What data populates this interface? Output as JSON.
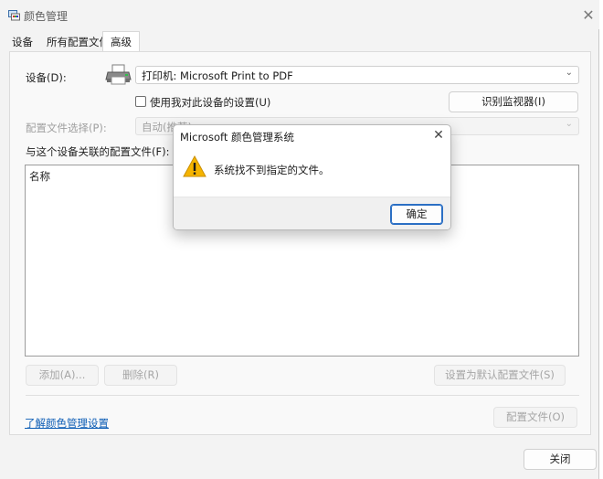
{
  "window": {
    "title": "颜色管理",
    "close_glyph": "✕"
  },
  "tabs": [
    {
      "label": "设备",
      "active": false
    },
    {
      "label": "所有配置文件",
      "active": false
    },
    {
      "label": "高级",
      "active": true
    }
  ],
  "device": {
    "label": "设备(D):",
    "selected": "打印机: Microsoft Print to PDF",
    "use_settings_label": "使用我对此设备的设置(U)",
    "use_settings_checked": false,
    "identify_button": "识别监视器(I)"
  },
  "profile_selection": {
    "label": "配置文件选择(P):",
    "selected": "自动(推荐)"
  },
  "associated_profiles": {
    "label": "与这个设备关联的配置文件(F):",
    "column_header": "名称",
    "rows": []
  },
  "actions": {
    "add": "添加(A)...",
    "remove": "删除(R)",
    "set_default": "设置为默认配置文件(S)",
    "profiles": "配置文件(O)"
  },
  "footer": {
    "learn_more_link": "了解颜色管理设置",
    "close_button": "关闭"
  },
  "dialog": {
    "title": "Microsoft 颜色管理系统",
    "close_glyph": "✕",
    "message": "系统找不到指定的文件。",
    "ok_button": "确定",
    "icon": "warning-icon"
  },
  "icons": {
    "chevron": "⌄"
  },
  "colors": {
    "link": "#0b5cb5",
    "primary_border": "#2b6fc4",
    "warning_fill": "#f5b400"
  }
}
